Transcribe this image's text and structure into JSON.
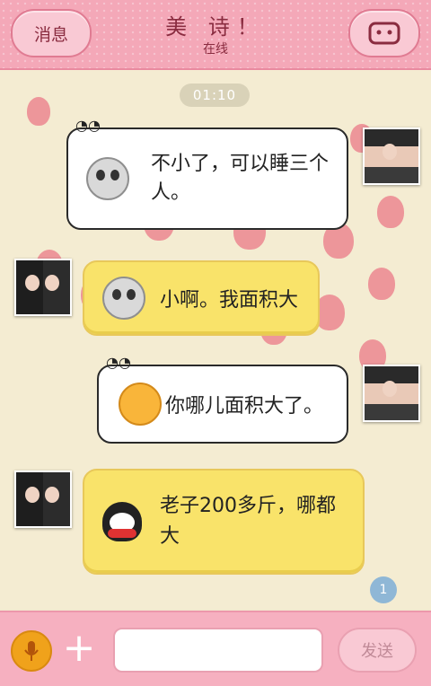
{
  "header": {
    "back_label": "消息",
    "title": "美 诗！",
    "status": "在线",
    "menu_icon": "face-icon"
  },
  "timestamp": "01:10",
  "messages": [
    {
      "side": "right",
      "avatar": "girl-avatar",
      "emoji": "skull-emoji",
      "text": "不小了，可以睡三个人。"
    },
    {
      "side": "left",
      "avatar": "couple-avatar",
      "emoji": "skull-emoji",
      "text": "小啊。我面积大"
    },
    {
      "side": "right",
      "avatar": "girl-avatar",
      "emoji": "sleepy-emoji",
      "text": "你哪儿面积大了。"
    },
    {
      "side": "left",
      "avatar": "couple-avatar",
      "emoji": "penguin-emoji",
      "text": "老子200多斤，哪都大"
    }
  ],
  "input": {
    "placeholder": "",
    "value": ""
  },
  "send_label": "发送",
  "unread_count": "1",
  "colors": {
    "header_pink": "#f4a8b8",
    "bubble_yellow": "#f9e36a",
    "bubble_white": "#ffffff",
    "balloon_red": "#e8506c"
  }
}
